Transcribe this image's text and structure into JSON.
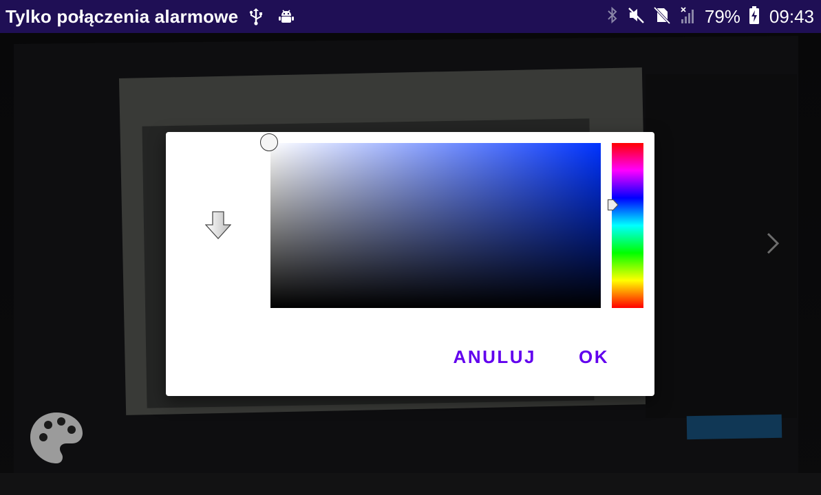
{
  "status_bar": {
    "carrier_text": "Tylko połączenia alarmowe",
    "battery_percent": "79%",
    "time": "09:43",
    "left_icons": [
      "usb-icon",
      "android-debug-icon"
    ],
    "right_icons": [
      "bluetooth-icon",
      "mute-icon",
      "no-sim-icon",
      "signal-icon",
      "battery-charging-icon"
    ]
  },
  "dialog": {
    "hue_color": "#0033ff",
    "hue_position_fraction": 0.375,
    "saturation": 0.0,
    "value": 1.0,
    "preview_icon": "arrow-down-icon",
    "cancel_label": "ANULUJ",
    "ok_label": "OK"
  },
  "fab": {
    "icon": "palette-icon"
  },
  "colors": {
    "status_bar_bg": "#1f0f55",
    "accent": "#6200ee",
    "dialog_bg": "#ffffff"
  }
}
